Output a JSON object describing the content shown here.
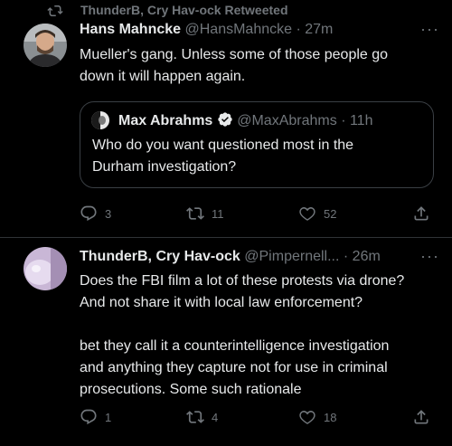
{
  "retweet": {
    "icon": "retweet-icon",
    "label": "ThunderB, Cry Hav-ock Retweeted"
  },
  "tweet1": {
    "name": "Hans Mahncke",
    "handle": "@HansMahncke",
    "dot": "·",
    "time": "27m",
    "more": "···",
    "lines": [
      "Mueller's gang. Unless some of those people go",
      "down it will happen again."
    ],
    "quote": {
      "name": "Max Abrahms",
      "verified_icon": "verified-badge-icon",
      "handle": "@MaxAbrahms",
      "dot": "·",
      "time": "11h",
      "lines": [
        "Who do you want questioned most in the",
        "Durham investigation?"
      ]
    },
    "actions": {
      "replies": "3",
      "retweets": "11",
      "likes": "52"
    }
  },
  "tweet2": {
    "name": "ThunderB, Cry Hav-ock",
    "handle": "@Pimpernell...",
    "dot": "·",
    "time": "26m",
    "more": "···",
    "lines": [
      "Does the FBI film a lot of these protests via drone?",
      "And not share it with local law enforcement?",
      "",
      "bet they call it a counterintelligence investigation",
      "and anything they capture not for use in criminal",
      "prosecutions.  Some such rationale"
    ],
    "actions": {
      "replies": "1",
      "retweets": "4",
      "likes": "18"
    }
  },
  "colors": {
    "background": "#000000",
    "text": "#e7e9ea",
    "muted": "#71767b",
    "border": "#2f3336",
    "verified": "#1d9bf0"
  }
}
